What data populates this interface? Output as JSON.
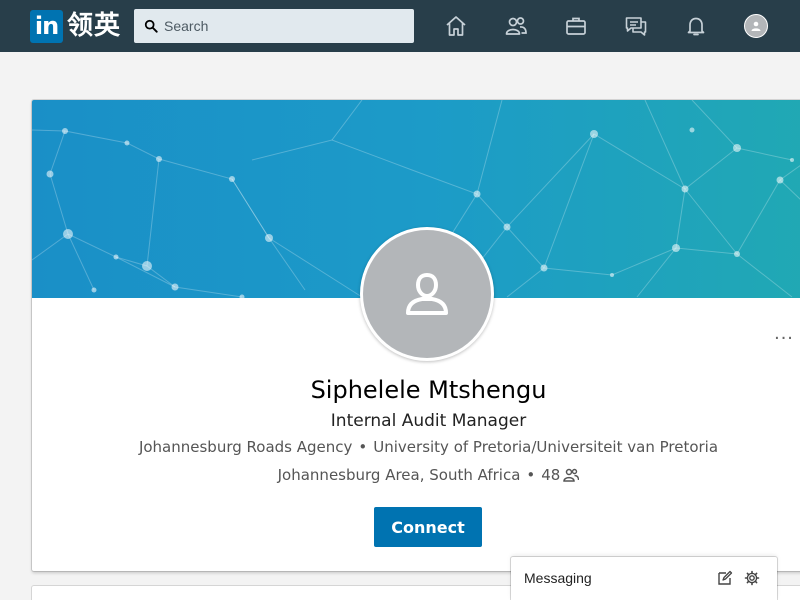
{
  "nav": {
    "logo_in": "in",
    "logo_text": "领英",
    "search_placeholder": "Search",
    "icons": [
      "home-icon",
      "network-icon",
      "jobs-icon",
      "messaging-icon",
      "notifications-icon",
      "me-avatar"
    ]
  },
  "profile": {
    "name": "Siphelele Mtshengu",
    "headline": "Internal Audit Manager",
    "company": "Johannesburg Roads Agency",
    "education": "University of Pretoria/Universiteit van Pretoria",
    "location": "Johannesburg Area, South Africa",
    "connections": "48",
    "separator": "•",
    "more_label": "...",
    "connect_label": "Connect"
  },
  "messaging": {
    "label": "Messaging",
    "icons": [
      "compose-icon",
      "settings-icon"
    ]
  },
  "colors": {
    "nav_bg": "#283e4a",
    "brand_blue": "#0073b1",
    "page_bg": "#f3f3f3",
    "banner_start": "#1a8fc7",
    "banner_end": "#21a9b3"
  }
}
